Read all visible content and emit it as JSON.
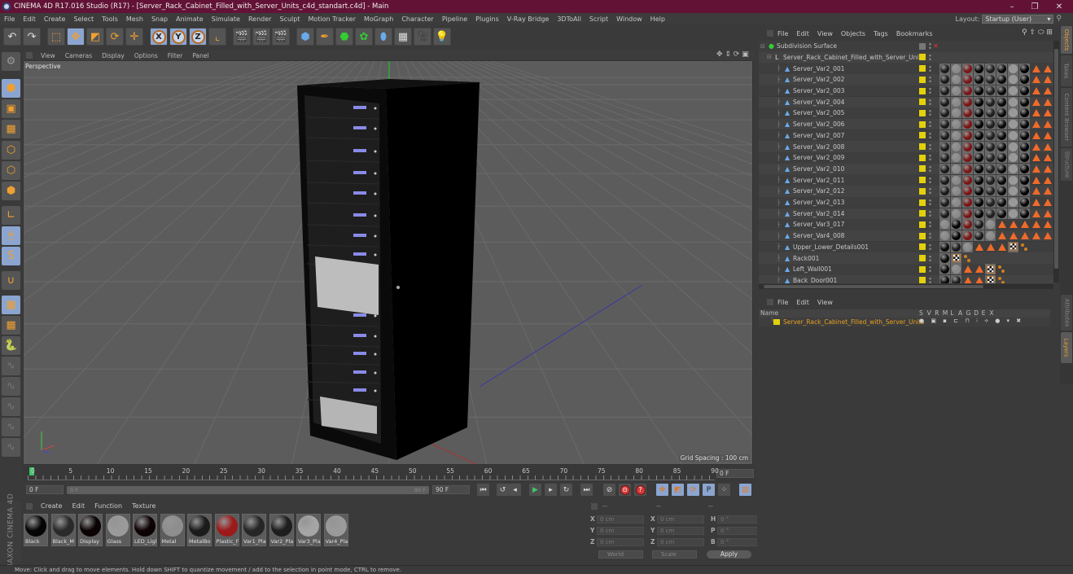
{
  "window": {
    "title": "CINEMA 4D R17.016 Studio (R17) - [Server_Rack_Cabinet_Filled_with_Server_Units_c4d_standart.c4d] - Main",
    "controls": [
      "–",
      "❐",
      "✕"
    ]
  },
  "menubar": {
    "items": [
      "File",
      "Edit",
      "Create",
      "Select",
      "Tools",
      "Mesh",
      "Snap",
      "Animate",
      "Simulate",
      "Render",
      "Sculpt",
      "Motion Tracker",
      "MoGraph",
      "Character",
      "Pipeline",
      "Plugins",
      "V-Ray Bridge",
      "3DToAll",
      "Script",
      "Window",
      "Help"
    ],
    "layout_label": "Layout:",
    "layout_value": "Startup (User)"
  },
  "toolbar": {
    "tools": [
      {
        "name": "undo-icon",
        "glyph": "↶"
      },
      {
        "name": "redo-icon",
        "glyph": "↷"
      },
      {
        "name": "live-selection-icon",
        "glyph": "⬚"
      },
      {
        "name": "move-icon",
        "glyph": "✥"
      },
      {
        "name": "scale-icon",
        "glyph": "◩"
      },
      {
        "name": "rotate-icon",
        "glyph": "⟳"
      },
      {
        "name": "recent-tool-icon",
        "glyph": "✛"
      },
      {
        "name": "x-axis-lock",
        "glyph": "X"
      },
      {
        "name": "y-axis-lock",
        "glyph": "Y"
      },
      {
        "name": "z-axis-lock",
        "glyph": "Z"
      },
      {
        "name": "coordinate-system-icon",
        "glyph": "⌞"
      },
      {
        "name": "render-view-icon",
        "glyph": "🎬"
      },
      {
        "name": "render-picture-viewer-icon",
        "glyph": "🎬"
      },
      {
        "name": "render-settings-icon",
        "glyph": "🎬"
      },
      {
        "name": "cube-icon",
        "glyph": "⬢"
      },
      {
        "name": "pen-spline-icon",
        "glyph": "✒"
      },
      {
        "name": "subdivision-surface-icon",
        "glyph": "⬣"
      },
      {
        "name": "cloner-icon",
        "glyph": "✿"
      },
      {
        "name": "deformer-icon",
        "glyph": "⬮"
      },
      {
        "name": "floor-icon",
        "glyph": "▦"
      },
      {
        "name": "camera-icon",
        "glyph": "🎥"
      },
      {
        "name": "light-icon",
        "glyph": "💡"
      }
    ]
  },
  "leftbar": {
    "tools": [
      {
        "name": "make-editable-icon",
        "glyph": "⚙",
        "active": false
      },
      {
        "name": "model-mode-icon",
        "glyph": "⬢",
        "active": true
      },
      {
        "name": "texture-mode-icon",
        "glyph": "▣",
        "active": false
      },
      {
        "name": "workplane-mode-icon",
        "glyph": "▦",
        "active": false
      },
      {
        "name": "points-mode-icon",
        "glyph": "⬡",
        "active": false
      },
      {
        "name": "edges-mode-icon",
        "glyph": "⬡",
        "active": false
      },
      {
        "name": "polygons-mode-icon",
        "glyph": "⬢",
        "active": false
      },
      {
        "name": "enable-axis-icon",
        "glyph": "∟",
        "active": false
      },
      {
        "name": "tweak-mode-icon",
        "glyph": "🖱",
        "active": true
      },
      {
        "name": "solo-icon",
        "glyph": "S",
        "active": true
      },
      {
        "name": "snap-icon",
        "glyph": "∪",
        "active": false
      },
      {
        "name": "workplane-lock-icon",
        "glyph": "▦",
        "active": true
      },
      {
        "name": "workplane-align-icon",
        "glyph": "▦",
        "active": false
      },
      {
        "name": "python-icon",
        "glyph": "🐍",
        "active": false
      },
      {
        "name": "script-1-icon",
        "glyph": "∿",
        "active": false
      },
      {
        "name": "script-2-icon",
        "glyph": "∿",
        "active": false
      },
      {
        "name": "script-3-icon",
        "glyph": "∿",
        "active": false
      },
      {
        "name": "script-4-icon",
        "glyph": "∿",
        "active": false
      },
      {
        "name": "script-5-icon",
        "glyph": "∿",
        "active": false
      }
    ]
  },
  "viewport": {
    "menu": [
      "View",
      "Cameras",
      "Display",
      "Options",
      "Filter",
      "Panel"
    ],
    "camera_label": "Perspective",
    "grid_spacing": "Grid Spacing : 100 cm"
  },
  "timeline": {
    "ticks": [
      "0",
      "5",
      "10",
      "15",
      "20",
      "25",
      "30",
      "35",
      "40",
      "45",
      "50",
      "55",
      "60",
      "65",
      "70",
      "75",
      "80",
      "85",
      "90"
    ],
    "current_frame": "0 F",
    "start_frame": "0 F",
    "range_start": "0 F",
    "range_end": "90 F",
    "end_frame": "90 F"
  },
  "transport": {
    "buttons": [
      {
        "name": "go-to-start-button",
        "glyph": "⏮"
      },
      {
        "name": "go-to-previous-keyframe-button",
        "glyph": "↺"
      },
      {
        "name": "go-to-previous-frame-button",
        "glyph": "◂"
      },
      {
        "name": "play-forward-button",
        "glyph": "▶"
      },
      {
        "name": "go-to-next-frame-button",
        "glyph": "▸"
      },
      {
        "name": "go-to-next-keyframe-button",
        "glyph": "↻"
      },
      {
        "name": "go-to-end-button",
        "glyph": "⏭"
      }
    ],
    "key_buttons": [
      {
        "name": "record-keys-disabled-button",
        "glyph": "⊘"
      },
      {
        "name": "autokeying-button",
        "glyph": "⊙"
      },
      {
        "name": "keyframe-selection-button",
        "glyph": "?"
      }
    ],
    "key_filters": [
      {
        "name": "key-position-icon",
        "glyph": "✥"
      },
      {
        "name": "key-scale-icon",
        "glyph": "◩"
      },
      {
        "name": "key-rotation-icon",
        "glyph": "⟳"
      },
      {
        "name": "key-parameter-icon",
        "glyph": "P"
      },
      {
        "name": "key-pla-icon",
        "glyph": "⁘"
      },
      {
        "name": "timeline-layout-icon",
        "glyph": "▤"
      }
    ]
  },
  "materials": {
    "menu": [
      "Create",
      "Edit",
      "Function",
      "Texture"
    ],
    "brand": "MAXON CINEMA 4D",
    "items": [
      {
        "label": "Black",
        "color": "#050505"
      },
      {
        "label": "Black_M",
        "color": "#2a2a2a"
      },
      {
        "label": "Display",
        "color": "#0a0203"
      },
      {
        "label": "Glass",
        "color": "#9a9a9a"
      },
      {
        "label": "LED_Ligl",
        "color": "#0d0204"
      },
      {
        "label": "Metal",
        "color": "#8e8e8e"
      },
      {
        "label": "MetalBo",
        "color": "#1b1b1b"
      },
      {
        "label": "Plastic_F",
        "color": "#9c1a1a"
      },
      {
        "label": "Var1_Pla",
        "color": "#262626"
      },
      {
        "label": "Var2_Pla",
        "color": "#1e1e1e"
      },
      {
        "label": "Var3_Pla",
        "color": "#a5a5a5"
      },
      {
        "label": "Var4_Pla",
        "color": "#9a9a9a"
      }
    ]
  },
  "coordinates": {
    "headers": [
      "--",
      "--",
      "--"
    ],
    "rows": [
      {
        "a": "X",
        "av": "0 cm",
        "b": "X",
        "bv": "0 cm",
        "c": "H",
        "cv": "0 °"
      },
      {
        "a": "Y",
        "av": "0 cm",
        "b": "Y",
        "bv": "0 cm",
        "c": "P",
        "cv": "0 °"
      },
      {
        "a": "Z",
        "av": "0 cm",
        "b": "Z",
        "bv": "0 cm",
        "c": "B",
        "cv": "0 °"
      }
    ],
    "mode": "World",
    "transform": "Scale",
    "apply": "Apply"
  },
  "objects": {
    "menu": [
      "File",
      "Edit",
      "View",
      "Objects",
      "Tags",
      "Bookmarks"
    ],
    "root": "Subdivision Surface",
    "group": "Server_Rack_Cabinet_Filled_with_Server_Units",
    "items": [
      {
        "name": "Server_Var2_001",
        "tags": "A"
      },
      {
        "name": "Server_Var2_002",
        "tags": "A"
      },
      {
        "name": "Server_Var2_003",
        "tags": "A"
      },
      {
        "name": "Server_Var2_004",
        "tags": "A"
      },
      {
        "name": "Server_Var2_005",
        "tags": "A"
      },
      {
        "name": "Server_Var2_006",
        "tags": "A"
      },
      {
        "name": "Server_Var2_007",
        "tags": "A"
      },
      {
        "name": "Server_Var2_008",
        "tags": "A"
      },
      {
        "name": "Server_Var2_009",
        "tags": "A"
      },
      {
        "name": "Server_Var2_010",
        "tags": "A"
      },
      {
        "name": "Server_Var2_011",
        "tags": "A"
      },
      {
        "name": "Server_Var2_012",
        "tags": "A"
      },
      {
        "name": "Server_Var2_013",
        "tags": "A"
      },
      {
        "name": "Server_Var2_014",
        "tags": "A"
      },
      {
        "name": "Server_Var3_017",
        "tags": "B"
      },
      {
        "name": "Server_Var4_008",
        "tags": "B"
      },
      {
        "name": "Upper_Lower_Details001",
        "tags": "C"
      },
      {
        "name": "Rack001",
        "tags": "D"
      },
      {
        "name": "Left_Wall001",
        "tags": "E"
      },
      {
        "name": "Back_Door001",
        "tags": "F"
      }
    ],
    "tag_sets": {
      "A": [
        "#1a1a1a",
        "#8a8a8a",
        "#7a1515",
        "#050505",
        "#202020",
        "#0a0a0a",
        "#9a9a9a",
        "#030303",
        "tri",
        "tri"
      ],
      "B": [
        "#8a8a8a",
        "#050505",
        "#7a1515",
        "#1a1a1a",
        "#8a8a8a",
        "tri",
        "tri",
        "tri",
        "tri",
        "tri"
      ],
      "C": [
        "#0a0a0a",
        "#1a1a1a",
        "#8a8a8a",
        "tri",
        "tri",
        "tri",
        "chk",
        "pts"
      ],
      "D": [
        "#0a0a0a",
        "chk",
        "pts"
      ],
      "E": [
        "#0a0a0a",
        "#8a8a8a",
        "tri",
        "tri",
        "chk",
        "pts"
      ],
      "F": [
        "#0a0a0a",
        "#1a1a1a",
        "tri",
        "tri",
        "chk",
        "pts"
      ]
    }
  },
  "side_tabs": {
    "top": [
      "Objects",
      "Takes",
      "Content Browser",
      "Structure"
    ],
    "bottom": [
      "Attributes",
      "Layers"
    ]
  },
  "layers": {
    "menu": [
      "File",
      "Edit",
      "View"
    ],
    "columns": [
      "Name",
      "S",
      "V",
      "R",
      "M",
      "L",
      "A",
      "G",
      "D",
      "E",
      "X"
    ],
    "row": {
      "name": "Server_Rack_Cabinet_Filled_with_Server_Units",
      "color": "#e2d10b"
    }
  },
  "status": {
    "text": "Move: Click and drag to move elements. Hold down SHIFT to quantize movement / add to the selection in point mode, CTRL to remove."
  },
  "colors": {
    "titlebar": "#621335",
    "accent_orange": "#f0a030",
    "active_blue": "#8ba5d0",
    "layer_yellow": "#e2d10b",
    "layer_name": "#e8a020"
  }
}
